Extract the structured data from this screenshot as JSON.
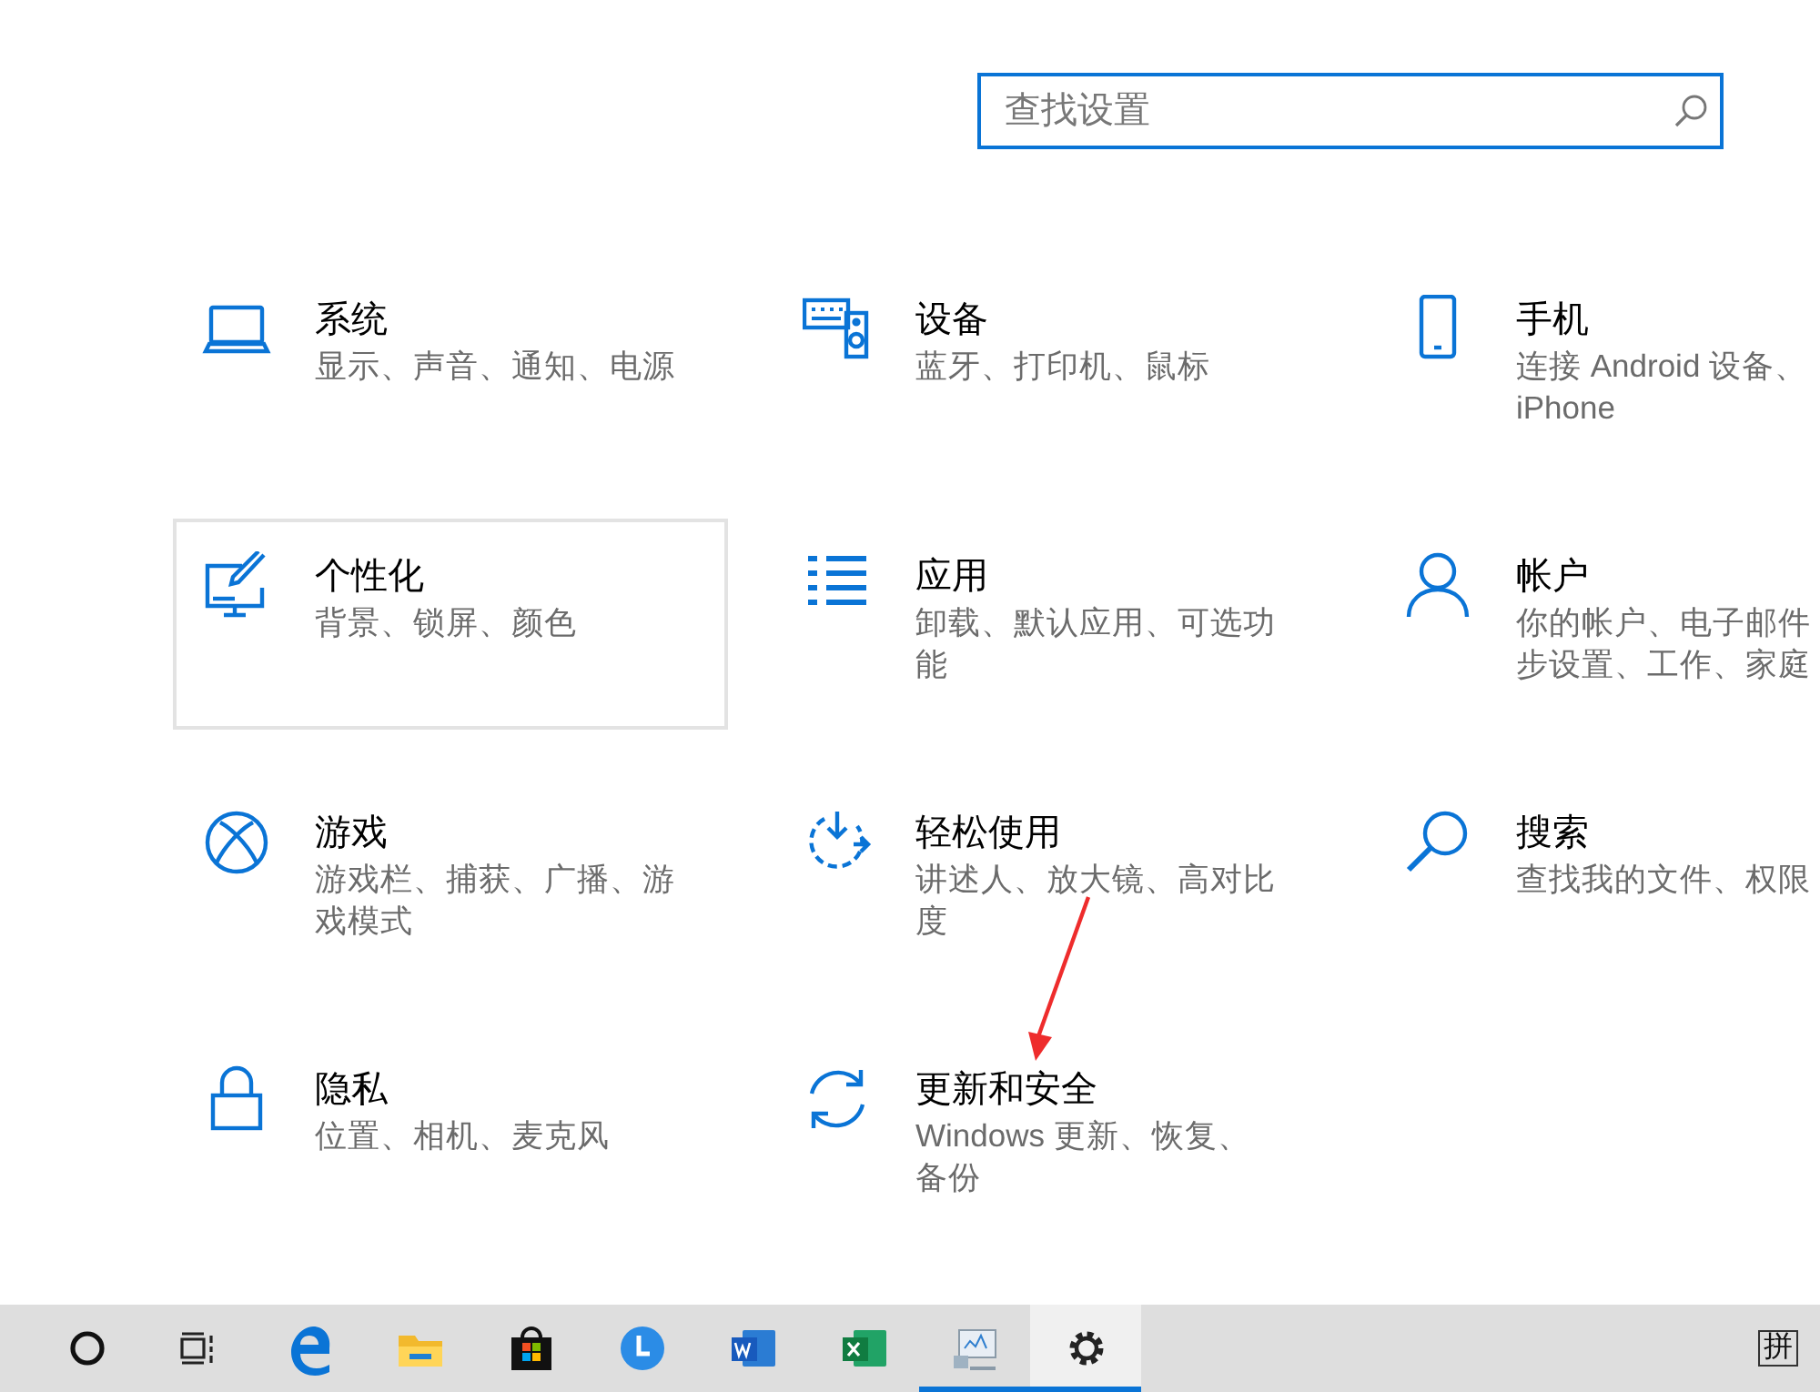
{
  "search": {
    "placeholder": "查找设置"
  },
  "tiles": [
    {
      "kind": "laptop",
      "title": "系统",
      "lines": [
        "显示、声音、通知、电源"
      ],
      "hovered": false
    },
    {
      "kind": "keyboard",
      "title": "设备",
      "lines": [
        "蓝牙、打印机、鼠标"
      ],
      "hovered": false
    },
    {
      "kind": "phone",
      "title": "手机",
      "lines": [
        "连接 Android 设备、",
        "iPhone"
      ],
      "hovered": false
    },
    {
      "kind": "paint",
      "title": "个性化",
      "lines": [
        "背景、锁屏、颜色"
      ],
      "hovered": true
    },
    {
      "kind": "apps",
      "title": "应用",
      "lines": [
        "卸载、默认应用、可选功",
        "能"
      ],
      "hovered": false
    },
    {
      "kind": "person",
      "title": "帐户",
      "lines": [
        "你的帐户、电子邮件",
        "步设置、工作、家庭"
      ],
      "hovered": false
    },
    {
      "kind": "xbox",
      "title": "游戏",
      "lines": [
        "游戏栏、捕获、广播、游",
        "戏模式"
      ],
      "hovered": false
    },
    {
      "kind": "ease",
      "title": "轻松使用",
      "lines": [
        "讲述人、放大镜、高对比",
        "度"
      ],
      "hovered": false
    },
    {
      "kind": "search",
      "title": "搜索",
      "lines": [
        "查找我的文件、权限"
      ],
      "hovered": false
    },
    {
      "kind": "lock",
      "title": "隐私",
      "lines": [
        "位置、相机、麦克风"
      ],
      "hovered": false
    },
    {
      "kind": "sync",
      "title": "更新和安全",
      "lines": [
        "Windows 更新、恢复、",
        "备份"
      ],
      "hovered": false
    }
  ],
  "taskbar": {
    "items": [
      {
        "kind": "cortana",
        "running": false,
        "active": false
      },
      {
        "kind": "taskview",
        "running": false,
        "active": false
      },
      {
        "kind": "edge",
        "running": false,
        "active": false
      },
      {
        "kind": "folder",
        "running": false,
        "active": false
      },
      {
        "kind": "store",
        "running": false,
        "active": false
      },
      {
        "kind": "clock",
        "running": false,
        "active": false
      },
      {
        "kind": "word",
        "running": false,
        "active": false
      },
      {
        "kind": "excel",
        "running": false,
        "active": false
      },
      {
        "kind": "monitor",
        "running": true,
        "active": false
      },
      {
        "kind": "settings",
        "running": true,
        "active": true
      }
    ],
    "ime": "拼"
  }
}
